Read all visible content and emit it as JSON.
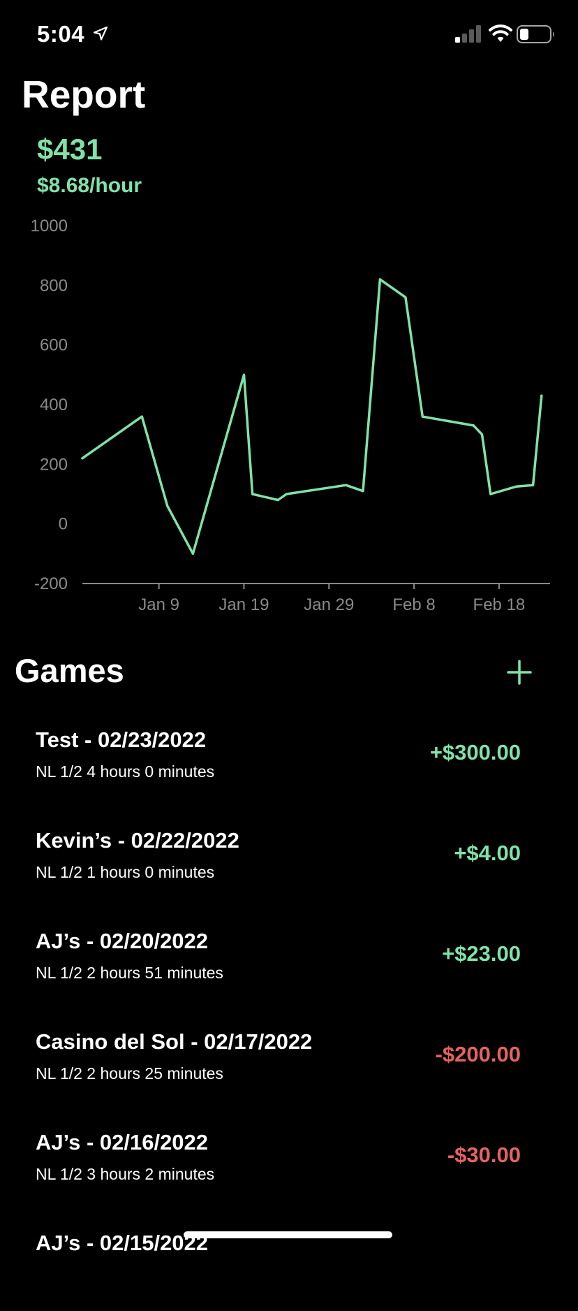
{
  "status_bar": {
    "time": "5:04",
    "location_icon": "location-arrow-icon",
    "signal_icon": "cellular-signal-icon",
    "wifi_icon": "wifi-icon",
    "battery_icon": "battery-icon"
  },
  "header": {
    "title": "Report",
    "total": "$431",
    "hourly": "$8.68/hour"
  },
  "colors": {
    "accent_green": "#7fe3a9",
    "loss_red": "#e5635f",
    "background": "#000000"
  },
  "chart_data": {
    "type": "line",
    "title": "",
    "xlabel": "",
    "ylabel": "",
    "ylim": [
      -200,
      1000
    ],
    "yticks": [
      "1000",
      "800",
      "600",
      "400",
      "200",
      "0",
      "-200"
    ],
    "xticks": [
      "Jan 9",
      "Jan 19",
      "Jan 29",
      "Feb 8",
      "Feb 18"
    ],
    "xlim": [
      "2021-12-31",
      "2022-02-24"
    ],
    "grid": false,
    "series": [
      {
        "color": "#7fe3a9",
        "points": [
          {
            "x": "2021-12-31",
            "y": 220
          },
          {
            "x": "2022-01-07",
            "y": 360
          },
          {
            "x": "2022-01-10",
            "y": 60
          },
          {
            "x": "2022-01-13",
            "y": -100
          },
          {
            "x": "2022-01-19",
            "y": 500
          },
          {
            "x": "2022-01-20",
            "y": 100
          },
          {
            "x": "2022-01-23",
            "y": 80
          },
          {
            "x": "2022-01-24",
            "y": 100
          },
          {
            "x": "2022-01-31",
            "y": 130
          },
          {
            "x": "2022-02-02",
            "y": 110
          },
          {
            "x": "2022-02-04",
            "y": 820
          },
          {
            "x": "2022-02-07",
            "y": 760
          },
          {
            "x": "2022-02-09",
            "y": 360
          },
          {
            "x": "2022-02-15",
            "y": 330
          },
          {
            "x": "2022-02-16",
            "y": 300
          },
          {
            "x": "2022-02-17",
            "y": 100
          },
          {
            "x": "2022-02-20",
            "y": 125
          },
          {
            "x": "2022-02-22",
            "y": 130
          },
          {
            "x": "2022-02-23",
            "y": 430
          }
        ]
      }
    ]
  },
  "games": {
    "title": "Games",
    "add_icon": "plus-icon",
    "items": [
      {
        "name": "Test - 02/23/2022",
        "detail": "NL 1/2 4 hours 0 minutes",
        "amount": "+$300.00",
        "positive": true
      },
      {
        "name": "Kevin’s - 02/22/2022",
        "detail": "NL 1/2 1 hours 0 minutes",
        "amount": "+$4.00",
        "positive": true
      },
      {
        "name": "AJ’s - 02/20/2022",
        "detail": "NL 1/2 2 hours 51 minutes",
        "amount": "+$23.00",
        "positive": true
      },
      {
        "name": "Casino del Sol - 02/17/2022",
        "detail": "NL 1/2 2 hours 25 minutes",
        "amount": "-$200.00",
        "positive": false
      },
      {
        "name": "AJ’s - 02/16/2022",
        "detail": "NL 1/2 3 hours 2 minutes",
        "amount": "-$30.00",
        "positive": false
      },
      {
        "name": "AJ’s - 02/15/2022",
        "detail": "",
        "amount": "",
        "positive": false
      }
    ]
  }
}
